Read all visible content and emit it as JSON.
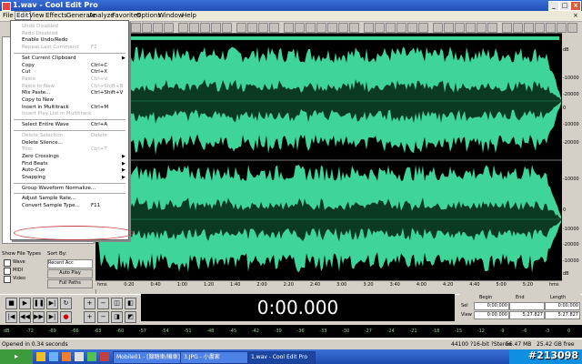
{
  "window": {
    "title": "1.wav - Cool Edit Pro"
  },
  "menubar": [
    "File",
    "Edit",
    "View",
    "Effects",
    "Generate",
    "Analyze",
    "Favorites",
    "Options",
    "Window",
    "Help"
  ],
  "edit_menu": {
    "items": [
      {
        "label": "Undo Disabled",
        "shortcut": "",
        "disabled": true
      },
      {
        "label": "Redo Disabled",
        "shortcut": "",
        "disabled": true
      },
      {
        "label": "Enable Undo/Redo",
        "shortcut": "",
        "disabled": false
      },
      {
        "label": "Repeat Last Command",
        "shortcut": "F2",
        "disabled": true
      },
      {
        "sep": true
      },
      {
        "label": "Set Current Clipboard",
        "shortcut": "",
        "disabled": false,
        "submenu": true
      },
      {
        "label": "Copy",
        "shortcut": "Ctrl+C",
        "disabled": false
      },
      {
        "label": "Cut",
        "shortcut": "Ctrl+X",
        "disabled": false
      },
      {
        "label": "Paste",
        "shortcut": "Ctrl+V",
        "disabled": true
      },
      {
        "label": "Paste to New",
        "shortcut": "Ctrl+Shift+N",
        "disabled": true
      },
      {
        "label": "Mix Paste...",
        "shortcut": "Ctrl+Shift+V",
        "disabled": false
      },
      {
        "label": "Copy to New",
        "shortcut": "",
        "disabled": false
      },
      {
        "label": "Insert in Multitrack",
        "shortcut": "Ctrl+M",
        "disabled": false
      },
      {
        "label": "Insert Play List in Multitrack",
        "shortcut": "",
        "disabled": true
      },
      {
        "sep": true
      },
      {
        "label": "Select Entire Wave",
        "shortcut": "Ctrl+A",
        "disabled": false
      },
      {
        "sep": true
      },
      {
        "label": "Delete Selection",
        "shortcut": "Delete",
        "disabled": true
      },
      {
        "label": "Delete Silence...",
        "shortcut": "",
        "disabled": false
      },
      {
        "label": "Trim",
        "shortcut": "Ctrl+T",
        "disabled": true
      },
      {
        "label": "Zero Crossings",
        "shortcut": "",
        "disabled": false,
        "submenu": true
      },
      {
        "label": "Find Beats",
        "shortcut": "",
        "disabled": false,
        "submenu": true
      },
      {
        "label": "Auto-Cue",
        "shortcut": "",
        "disabled": false,
        "submenu": true
      },
      {
        "label": "Snapping",
        "shortcut": "",
        "disabled": false,
        "submenu": true
      },
      {
        "sep": true
      },
      {
        "label": "Group Waveform Normalize...",
        "shortcut": "",
        "disabled": false
      },
      {
        "sep": true
      },
      {
        "label": "Adjust Sample Rate...",
        "shortcut": "",
        "disabled": false
      },
      {
        "label": "Convert Sample Type...",
        "shortcut": "F11",
        "disabled": false
      }
    ]
  },
  "left_panel": {
    "show_file_types": "Show File Types",
    "sort_by": "Sort By:",
    "types": [
      "Wave",
      "MIDI",
      "Video"
    ],
    "sort_value": "Recent Acc",
    "auto_play": "Auto Play",
    "full_paths": "Full Paths"
  },
  "db_scale_top": [
    "dB",
    "-10000",
    "-20000",
    "0",
    "-10000",
    "-20000"
  ],
  "db_scale_bottom": [
    "-10000",
    "0",
    "-10000",
    "-20000",
    "-10000",
    "dB"
  ],
  "time_ruler": [
    "hms",
    "0:20",
    "0:40",
    "1:00",
    "1:20",
    "1:40",
    "2:00",
    "2:20",
    "2:40",
    "3:00",
    "3:20",
    "3:40",
    "4:00",
    "4:20",
    "4:40",
    "5:00",
    "5:20",
    "hms"
  ],
  "time_display": "0:00.000",
  "selection_info": {
    "headers": [
      "Begin",
      "End",
      "Length"
    ],
    "rows": [
      {
        "label": "Sel",
        "begin": "0:00.000",
        "end": "",
        "length": "0:00.000"
      },
      {
        "label": "View",
        "begin": "0:00.000",
        "end": "5:27.827",
        "length": "5:27.827"
      }
    ]
  },
  "bottom_ruler": [
    "dB",
    "-72",
    "-69",
    "-66",
    "-63",
    "-60",
    "-57",
    "-54",
    "-51",
    "-48",
    "-45",
    "-42",
    "-39",
    "-36",
    "-33",
    "-30",
    "-27",
    "-24",
    "-21",
    "-18",
    "-15",
    "-12",
    "-9",
    "-6",
    "-3",
    "0"
  ],
  "status": {
    "message": "Opened in 0.34 seconds",
    "format": "44100 ?16-bit ?Stereo",
    "size": "56.47 MB",
    "free": "25.42 GB free"
  },
  "taskbar": {
    "items": [
      "Mobile01 - [腳踏車/機車]",
      "3.JPG - 小畵家",
      "1.wav - Cool Edit Pro"
    ],
    "clock": "上午 11:05"
  },
  "watermark": "#213098",
  "colors": {
    "wave": "#3ed49a",
    "background": "#000000"
  }
}
